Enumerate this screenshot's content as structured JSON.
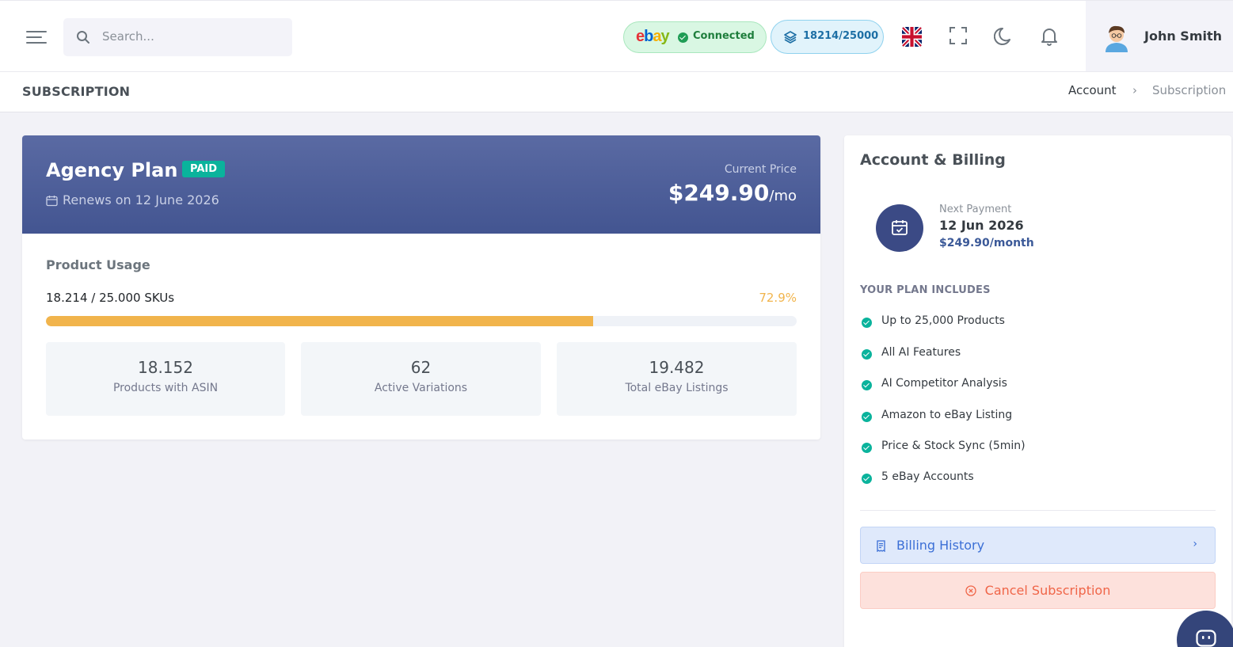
{
  "header": {
    "search_placeholder": "Search...",
    "ebay_status": "Connected",
    "sku_count": "18214/25000",
    "language": "English (UK)",
    "user_name": "John Smith"
  },
  "page": {
    "title": "SUBSCRIPTION",
    "breadcrumb": [
      "Account",
      "Subscription"
    ]
  },
  "plan": {
    "name": "Agency Plan",
    "badge": "PAID",
    "renews": "Renews on 12 June 2026",
    "price_label": "Current Price",
    "price": "$249.90",
    "price_period": "/mo",
    "usage_title": "Product Usage",
    "usage_text": "18.214 / 25.000 SKUs",
    "usage_percent_label": "72.9%",
    "usage_fraction": 0.729,
    "usage_color": "#f1b44c",
    "stats": [
      {
        "value": "18.152",
        "label": "Products with ASIN"
      },
      {
        "value": "62",
        "label": "Active Variations"
      },
      {
        "value": "19.482",
        "label": "Total eBay Listings"
      }
    ]
  },
  "billing": {
    "title": "Account & Billing",
    "next_payment_label": "Next Payment",
    "next_payment_date": "12 Jun 2026",
    "next_payment_amount": "$249.90/month",
    "includes_title": "YOUR PLAN INCLUDES",
    "features": [
      "Up to 25,000 Products",
      "All AI Features",
      "AI Competitor Analysis",
      "Amazon to eBay Listing",
      "Price & Stock Sync (5min)",
      "5 eBay Accounts"
    ],
    "history_button": "Billing History",
    "cancel_button": "Cancel Subscription"
  },
  "icons": {
    "menu": "hamburger-icon",
    "search": "search-icon",
    "layers": "layers-icon",
    "fullscreen": "fullscreen-icon",
    "theme": "moon-icon",
    "notifications": "bell-icon",
    "calendar": "calendar-icon",
    "chat": "chat-bot-icon"
  },
  "colors": {
    "accent": "#435591",
    "success": "#0ab39c",
    "warning": "#f1b44c",
    "danger": "#f06548",
    "info": "#3b6fd6"
  }
}
